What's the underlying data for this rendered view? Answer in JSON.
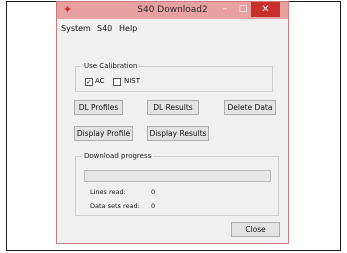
{
  "window": {
    "title": "S40 Download2"
  },
  "titlebar": {
    "close_glyph": "✕",
    "min_glyph": "–",
    "max_glyph": "□",
    "app_icon": "✦"
  },
  "menu": {
    "items": [
      {
        "label": "System"
      },
      {
        "label": "S40"
      },
      {
        "label": "Help"
      }
    ]
  },
  "calibration": {
    "group_label": "Use Calibration",
    "ac": {
      "label": "AC",
      "checked": true,
      "mark": "✓"
    },
    "nist": {
      "label": "NIST",
      "checked": false
    }
  },
  "buttons": {
    "dl_profiles": "DL Profiles",
    "dl_results": "DL Results",
    "delete_data": "Delete Data",
    "display_profile": "Display Profile",
    "display_results": "Display Results",
    "close": "Close"
  },
  "download": {
    "group_label": "Download progress",
    "progress": 0,
    "lines_read_label": "Lines read:",
    "lines_read_value": "0",
    "data_sets_label": "Data sets read:",
    "data_sets_value": "0"
  }
}
